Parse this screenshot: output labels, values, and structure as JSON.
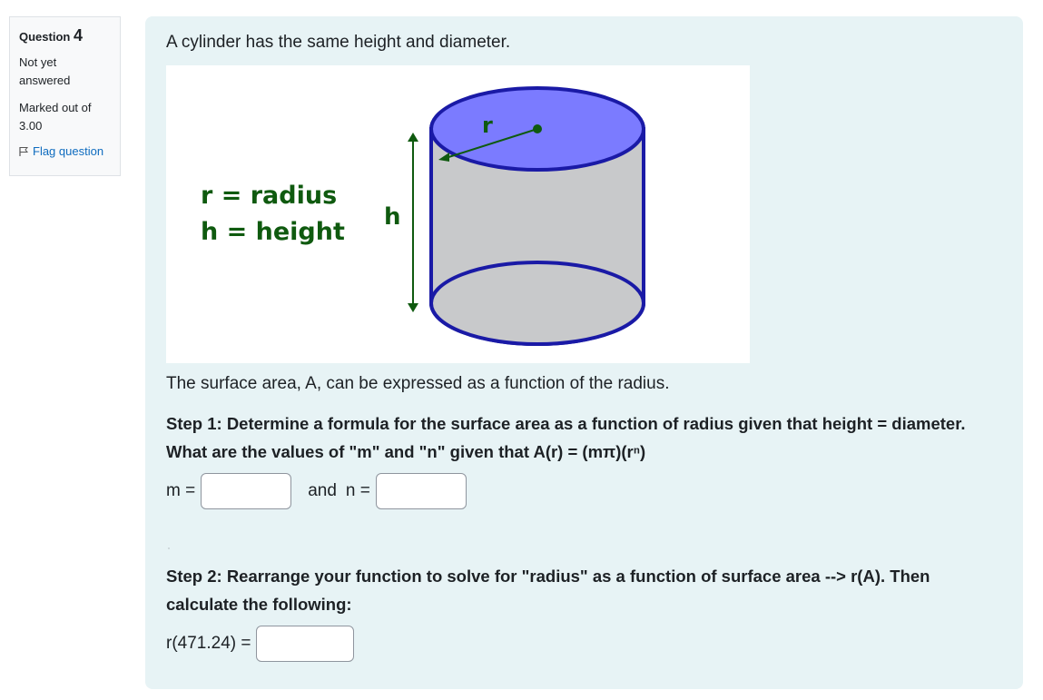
{
  "info": {
    "question_label": "Question",
    "question_number": "4",
    "state": "Not yet answered",
    "grade": "Marked out of 3.00",
    "flag_label": "Flag question"
  },
  "content": {
    "intro": "A cylinder has the same height and diameter.",
    "figure": {
      "legend_r": "r = radius",
      "legend_h": "h = height",
      "h_label": "h",
      "r_label": "r"
    },
    "surface_text": "The surface area, A, can be expressed as a function of the radius.",
    "step1": "Step 1:  Determine a formula for the surface area as a function of radius given that height = diameter.  What are the values of \"m\" and \"n\" given that A(r)  =  (mπ)(rⁿ)",
    "m_label": "m =",
    "and_label": "and",
    "n_label": "n =",
    "m_value": "",
    "n_value": "",
    "step2": "Step 2:  Rearrange your function to solve for \"radius\" as a function of surface area -->  r(A).  Then calculate the following:",
    "r_label": "r(471.24) =",
    "r_value": ""
  },
  "colors": {
    "panel_bg": "#e7f3f5",
    "link": "#0f6cbf",
    "cylinder_top": "#7b7bff",
    "cylinder_body": "#c8c9cb",
    "outline": "#1a1aa6",
    "green": "#0f5a0f"
  }
}
